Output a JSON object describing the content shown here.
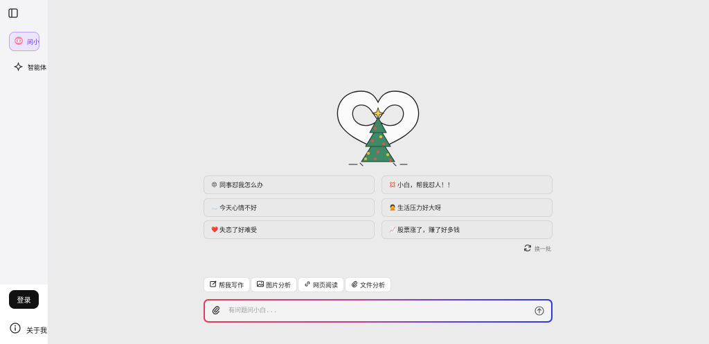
{
  "sidebar": {
    "active_item": "问小白",
    "items": [
      {
        "label": "智能体"
      }
    ],
    "login_label": "登录",
    "about_label": "关于我"
  },
  "suggestions": [
    {
      "emoji": "😡",
      "text": "同事怼我怎么办"
    },
    {
      "emoji": "💢",
      "text": "小白，帮我怼人！！"
    },
    {
      "emoji": "☁️",
      "text": "今天心情不好"
    },
    {
      "emoji": "🙅",
      "text": "生活压力好大呀"
    },
    {
      "emoji": "❤️",
      "text": "失恋了好难受"
    },
    {
      "emoji": "📈",
      "text": "股票涨了，赚了好多钱"
    }
  ],
  "refresh_label": "换一批",
  "tools": [
    {
      "icon": "edit-icon",
      "label": "帮我写作"
    },
    {
      "icon": "image-icon",
      "label": "图片分析"
    },
    {
      "icon": "link-icon",
      "label": "网页阅读"
    },
    {
      "icon": "paperclip-icon",
      "label": "文件分析"
    }
  ],
  "input": {
    "placeholder": "有问题问小白...",
    "value": ""
  },
  "colors": {
    "accent": "#5b2ee0",
    "gradient_start": "#e23c56",
    "gradient_end": "#2f3bd6"
  }
}
